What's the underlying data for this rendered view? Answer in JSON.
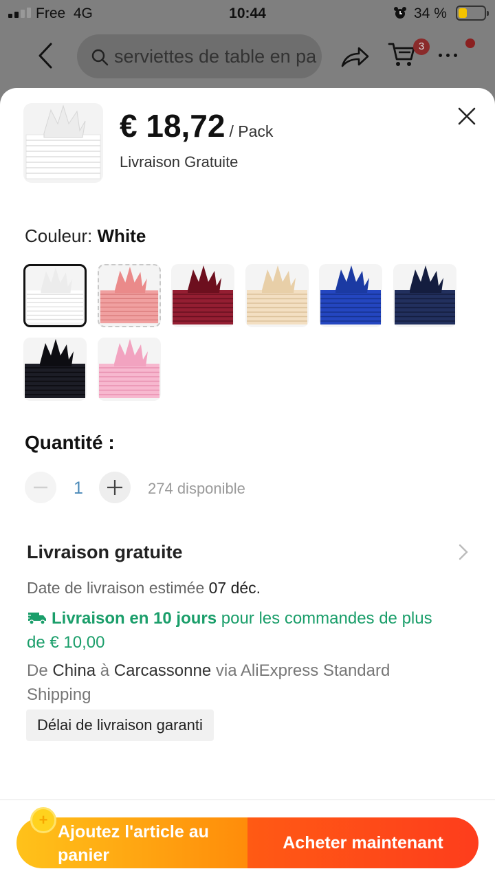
{
  "status_bar": {
    "carrier": "Free",
    "network": "4G",
    "time": "10:44",
    "battery_percent": "34 %"
  },
  "header": {
    "search_value": "serviettes de table en pa",
    "cart_count": "3"
  },
  "product": {
    "price": "€ 18,72",
    "price_unit": "/ Pack",
    "shipping_label": "Livraison Gratuite"
  },
  "color": {
    "label": "Couleur:",
    "selected": "White",
    "options": [
      {
        "name": "white",
        "fold": "#ececec",
        "stack": "#ffffff",
        "line": "#dcdcdc"
      },
      {
        "name": "salmon-pink",
        "fold": "#ea8a8a",
        "stack": "#f0a0a0",
        "line": "#d97a7a"
      },
      {
        "name": "burgundy",
        "fold": "#6d0f1e",
        "stack": "#941e32",
        "line": "#6a1020"
      },
      {
        "name": "beige",
        "fold": "#e8cfa8",
        "stack": "#f3dfc2",
        "line": "#dcc29b"
      },
      {
        "name": "royal-blue",
        "fold": "#1b3aa3",
        "stack": "#2446c0",
        "line": "#17328f"
      },
      {
        "name": "navy",
        "fold": "#141d3f",
        "stack": "#22305e",
        "line": "#141d3f"
      },
      {
        "name": "black",
        "fold": "#0d0d12",
        "stack": "#1c1d26",
        "line": "#0a0a0e"
      },
      {
        "name": "pink",
        "fold": "#f2a3c0",
        "stack": "#f7b8cf",
        "line": "#e88fb0"
      }
    ]
  },
  "quantity": {
    "title": "Quantité :",
    "value": "1",
    "available": "274 disponible"
  },
  "shipping": {
    "title": "Livraison gratuite",
    "date_prefix": "Date de livraison estimée",
    "date": "07 déc.",
    "fast_bold": "Livraison en 10 jours",
    "fast_rest": "pour les commandes de plus de € 10,00",
    "route_de": "De",
    "route_from": "China",
    "route_a": "à",
    "route_to": "Carcassonne",
    "route_via": "via AliExpress Standard Shipping",
    "guarantee": "Délai de livraison garanti"
  },
  "actions": {
    "add_to_cart": "Ajoutez l'article au panier",
    "buy_now": "Acheter maintenant"
  },
  "colors": {
    "accent_green": "#1a9e6a",
    "cart_gradient": "#ffc21a",
    "buy_gradient": "#ff5a14"
  }
}
